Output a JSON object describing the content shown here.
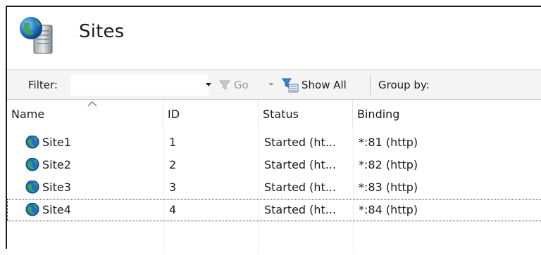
{
  "page": {
    "title": "Sites"
  },
  "toolbar": {
    "filter_label": "Filter:",
    "filter_value": "",
    "go_label": "Go",
    "show_all_label": "Show All",
    "group_by_label": "Group by:"
  },
  "table": {
    "columns": [
      "Name",
      "ID",
      "Status",
      "Binding"
    ],
    "sort_column": "Name",
    "rows": [
      {
        "name": "Site1",
        "id": "1",
        "status": "Started (ht...",
        "binding": "*:81 (http)"
      },
      {
        "name": "Site2",
        "id": "2",
        "status": "Started (ht...",
        "binding": "*:82 (http)"
      },
      {
        "name": "Site3",
        "id": "3",
        "status": "Started (ht...",
        "binding": "*:83 (http)"
      },
      {
        "name": "Site4",
        "id": "4",
        "status": "Started (ht...",
        "binding": "*:84 (http)"
      }
    ],
    "selected_row": "Site4"
  },
  "icons": {
    "header": "sites-server-globe-icon",
    "row": "globe-icon",
    "go": "funnel-icon",
    "show_all": "show-all-icon"
  },
  "colors": {
    "toolbar_bg": "#f4f4f4",
    "accent": "#1f6fc5"
  }
}
